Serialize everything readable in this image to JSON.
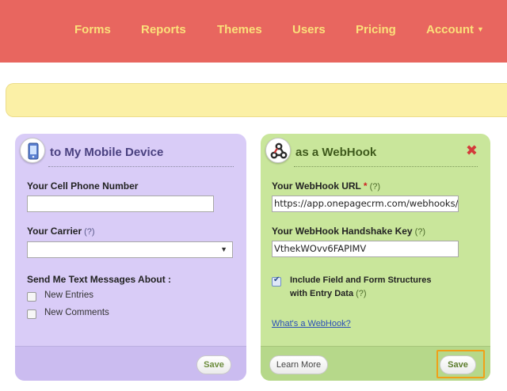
{
  "nav": {
    "items": [
      {
        "label": "Forms"
      },
      {
        "label": "Reports"
      },
      {
        "label": "Themes"
      },
      {
        "label": "Users"
      },
      {
        "label": "Pricing"
      },
      {
        "label": "Account"
      }
    ]
  },
  "colors": {
    "nav_bg": "#e8665f",
    "nav_text": "#fbe07a",
    "notice_bg": "#fbf0a6",
    "mobile_panel_bg": "#d9ccf7",
    "webhook_panel_bg": "#c9e69b",
    "close_icon": "#d33a3a",
    "focus_ring": "#f0a018"
  },
  "mobile": {
    "title": "to My Mobile Device",
    "icon": "mobile-phone-icon",
    "cell_label": "Your Cell Phone Number",
    "cell_value": "",
    "carrier_label": "Your Carrier",
    "carrier_help": "(?)",
    "carrier_value": "",
    "texts_label": "Send Me Text Messages About :",
    "options": [
      {
        "label": "New Entries",
        "checked": false
      },
      {
        "label": "New Comments",
        "checked": false
      }
    ],
    "save_label": "Save"
  },
  "webhook": {
    "title": "as a WebHook",
    "icon": "webhook-icon",
    "url_label": "Your WebHook URL",
    "url_required": "*",
    "url_help": "(?)",
    "url_value": "https://app.onepagecrm.com/webhooks/v",
    "key_label": "Your WebHook Handshake Key",
    "key_help": "(?)",
    "key_value": "VthekWOvv6FAPIMV",
    "include_label": "Include Field and Form Structures with Entry Data",
    "include_help": "(?)",
    "include_checked": true,
    "whats_link": "What's a WebHook?",
    "learn_more_label": "Learn More",
    "save_label": "Save"
  }
}
